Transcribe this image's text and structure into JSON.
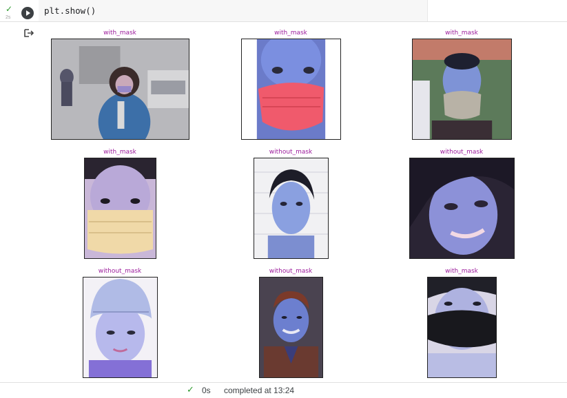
{
  "cell": {
    "code": "plt.show()",
    "exec_time": "2s",
    "run_label": "Run cell"
  },
  "panels": [
    {
      "title": "with_mask"
    },
    {
      "title": "with_mask"
    },
    {
      "title": "with_mask"
    },
    {
      "title": "with_mask"
    },
    {
      "title": "without_mask"
    },
    {
      "title": "without_mask"
    },
    {
      "title": "without_mask"
    },
    {
      "title": "without_mask"
    },
    {
      "title": "with_mask"
    }
  ],
  "statusbar": {
    "check": "✓",
    "duration": "0s",
    "completed": "completed at 13:24"
  },
  "colors": {
    "title": "#9b1a9b",
    "success": "#2e9b2e"
  }
}
